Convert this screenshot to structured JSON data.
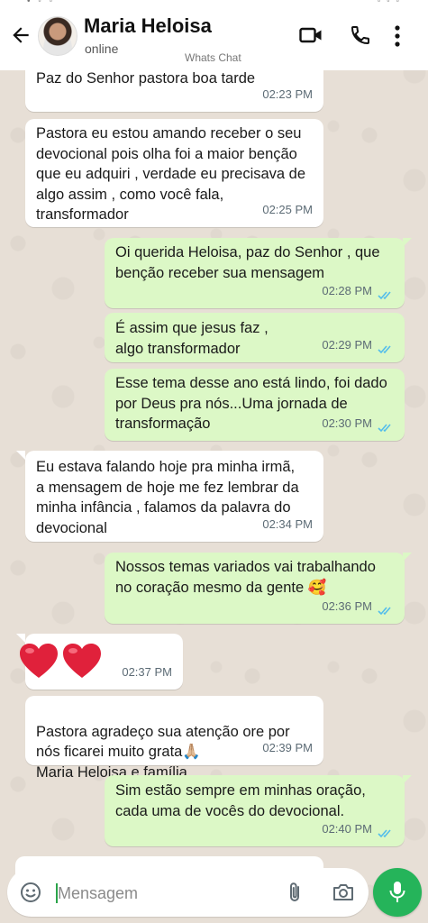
{
  "header": {
    "contact_name": "Maria Heloisa",
    "contact_status": "online",
    "watermark": "Whats Chat"
  },
  "messages": [
    {
      "direction": "in",
      "text": "Paz do Senhor pastora  boa tarde",
      "time": "02:23 PM"
    },
    {
      "direction": "in",
      "text": "Pastora eu estou amando receber o seu devocional pois olha foi a maior benção que eu adquiri , verdade eu precisava de algo assim , como você fala,  transformador",
      "time": "02:25 PM"
    },
    {
      "direction": "out",
      "text": "Oi querida Heloisa, paz do Senhor , que benção receber sua mensagem",
      "time": "02:28 PM",
      "read": true
    },
    {
      "direction": "out",
      "text": "É assim que jesus faz , algo transformador",
      "time": "02:29 PM",
      "read": true
    },
    {
      "direction": "out",
      "text": "Esse tema desse ano está lindo, foi dado por Deus pra nós...Uma jornada de transformação",
      "time": "02:30 PM",
      "read": true
    },
    {
      "direction": "in",
      "text": "Eu estava falando hoje pra minha irmã, a mensagem de hoje me fez lembrar da minha infância , falamos da palavra do devocional",
      "time": "02:34 PM"
    },
    {
      "direction": "out",
      "text": "Nossos temas variados vai trabalhando no coração mesmo da gente 🥰",
      "time": "02:36 PM",
      "read": true
    },
    {
      "direction": "in",
      "text": "❤️❤️",
      "time": "02:37 PM"
    },
    {
      "direction": "in",
      "text": "Pastora agradeço sua atenção ore por nós ficarei muito grata🙏🏼\nMaria Heloisa e família",
      "time": "02:39 PM"
    },
    {
      "direction": "out",
      "text": "Sim estão sempre em minhas oração, cada uma de vocês do devocional.",
      "time": "02:40 PM",
      "read": true
    }
  ],
  "input": {
    "placeholder": "Mensagem",
    "value": ""
  },
  "icons": {
    "back": "arrow-left-icon",
    "video": "video-camera-icon",
    "call": "phone-icon",
    "menu": "more-vertical-icon",
    "emoji": "emoji-icon",
    "attach": "paperclip-icon",
    "camera": "camera-icon",
    "mic": "microphone-icon"
  },
  "colors": {
    "incoming_bubble": "#ffffff",
    "outgoing_bubble": "#dcf8c6",
    "read_ticks": "#53bdeb",
    "mic_button": "#25b45a",
    "heart": "#e0213b"
  }
}
